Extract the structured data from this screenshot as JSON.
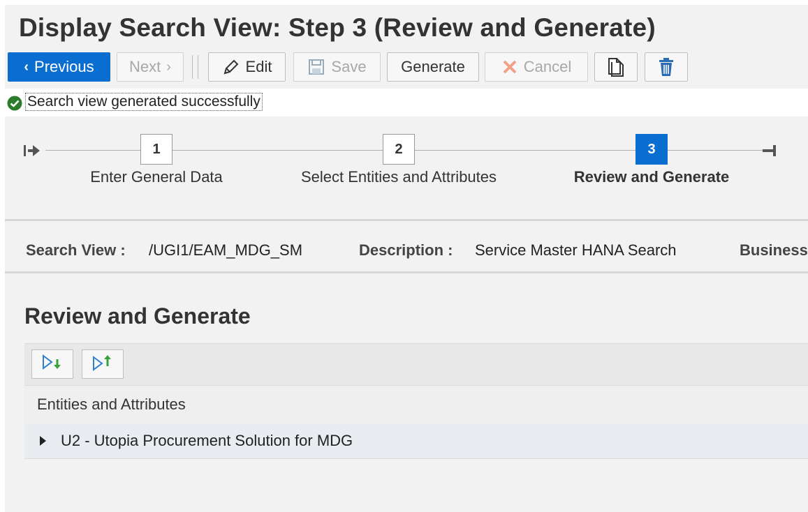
{
  "page": {
    "title": "Display Search View: Step 3  (Review and Generate)"
  },
  "toolbar": {
    "previous_label": "Previous",
    "next_label": "Next",
    "edit_label": "Edit",
    "save_label": "Save",
    "generate_label": "Generate",
    "cancel_label": "Cancel",
    "icons": [
      "chevron-left-icon",
      "chevron-right-icon",
      "pencil-icon",
      "save-icon",
      "cancel-x-icon",
      "copy-icon",
      "trash-icon"
    ]
  },
  "message": {
    "text": "Search view generated successfully",
    "type": "success",
    "color": "#2b7d2b"
  },
  "roadmap": {
    "steps": [
      {
        "number": "1",
        "label": "Enter General Data",
        "active": false
      },
      {
        "number": "2",
        "label": "Select Entities and Attributes",
        "active": false
      },
      {
        "number": "3",
        "label": "Review and Generate",
        "active": true
      }
    ],
    "accent": "#0a6ed1"
  },
  "header_info": {
    "search_view_label": "Search View :",
    "search_view_value": "/UGI1/EAM_MDG_SM",
    "description_label": "Description :",
    "description_value": "Service Master HANA Search",
    "business_label": "Business"
  },
  "section": {
    "title": "Review and Generate",
    "column_header": "Entities and Attributes",
    "rows": [
      {
        "label": "U2 - Utopia Procurement Solution for MDG",
        "expanded": false
      }
    ],
    "tool_icons": [
      "expand-all-icon",
      "collapse-all-icon"
    ]
  }
}
